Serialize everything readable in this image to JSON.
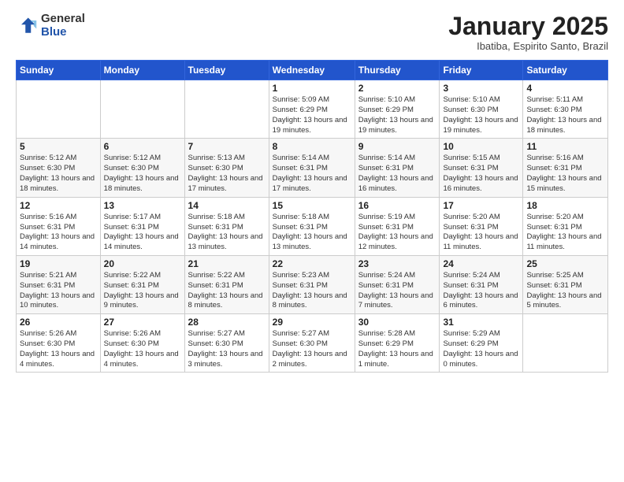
{
  "logo": {
    "general": "General",
    "blue": "Blue"
  },
  "header": {
    "month": "January 2025",
    "location": "Ibatiba, Espirito Santo, Brazil"
  },
  "weekdays": [
    "Sunday",
    "Monday",
    "Tuesday",
    "Wednesday",
    "Thursday",
    "Friday",
    "Saturday"
  ],
  "weeks": [
    [
      {
        "day": "",
        "info": ""
      },
      {
        "day": "",
        "info": ""
      },
      {
        "day": "",
        "info": ""
      },
      {
        "day": "1",
        "info": "Sunrise: 5:09 AM\nSunset: 6:29 PM\nDaylight: 13 hours\nand 19 minutes."
      },
      {
        "day": "2",
        "info": "Sunrise: 5:10 AM\nSunset: 6:29 PM\nDaylight: 13 hours\nand 19 minutes."
      },
      {
        "day": "3",
        "info": "Sunrise: 5:10 AM\nSunset: 6:30 PM\nDaylight: 13 hours\nand 19 minutes."
      },
      {
        "day": "4",
        "info": "Sunrise: 5:11 AM\nSunset: 6:30 PM\nDaylight: 13 hours\nand 18 minutes."
      }
    ],
    [
      {
        "day": "5",
        "info": "Sunrise: 5:12 AM\nSunset: 6:30 PM\nDaylight: 13 hours\nand 18 minutes."
      },
      {
        "day": "6",
        "info": "Sunrise: 5:12 AM\nSunset: 6:30 PM\nDaylight: 13 hours\nand 18 minutes."
      },
      {
        "day": "7",
        "info": "Sunrise: 5:13 AM\nSunset: 6:30 PM\nDaylight: 13 hours\nand 17 minutes."
      },
      {
        "day": "8",
        "info": "Sunrise: 5:14 AM\nSunset: 6:31 PM\nDaylight: 13 hours\nand 17 minutes."
      },
      {
        "day": "9",
        "info": "Sunrise: 5:14 AM\nSunset: 6:31 PM\nDaylight: 13 hours\nand 16 minutes."
      },
      {
        "day": "10",
        "info": "Sunrise: 5:15 AM\nSunset: 6:31 PM\nDaylight: 13 hours\nand 16 minutes."
      },
      {
        "day": "11",
        "info": "Sunrise: 5:16 AM\nSunset: 6:31 PM\nDaylight: 13 hours\nand 15 minutes."
      }
    ],
    [
      {
        "day": "12",
        "info": "Sunrise: 5:16 AM\nSunset: 6:31 PM\nDaylight: 13 hours\nand 14 minutes."
      },
      {
        "day": "13",
        "info": "Sunrise: 5:17 AM\nSunset: 6:31 PM\nDaylight: 13 hours\nand 14 minutes."
      },
      {
        "day": "14",
        "info": "Sunrise: 5:18 AM\nSunset: 6:31 PM\nDaylight: 13 hours\nand 13 minutes."
      },
      {
        "day": "15",
        "info": "Sunrise: 5:18 AM\nSunset: 6:31 PM\nDaylight: 13 hours\nand 13 minutes."
      },
      {
        "day": "16",
        "info": "Sunrise: 5:19 AM\nSunset: 6:31 PM\nDaylight: 13 hours\nand 12 minutes."
      },
      {
        "day": "17",
        "info": "Sunrise: 5:20 AM\nSunset: 6:31 PM\nDaylight: 13 hours\nand 11 minutes."
      },
      {
        "day": "18",
        "info": "Sunrise: 5:20 AM\nSunset: 6:31 PM\nDaylight: 13 hours\nand 11 minutes."
      }
    ],
    [
      {
        "day": "19",
        "info": "Sunrise: 5:21 AM\nSunset: 6:31 PM\nDaylight: 13 hours\nand 10 minutes."
      },
      {
        "day": "20",
        "info": "Sunrise: 5:22 AM\nSunset: 6:31 PM\nDaylight: 13 hours\nand 9 minutes."
      },
      {
        "day": "21",
        "info": "Sunrise: 5:22 AM\nSunset: 6:31 PM\nDaylight: 13 hours\nand 8 minutes."
      },
      {
        "day": "22",
        "info": "Sunrise: 5:23 AM\nSunset: 6:31 PM\nDaylight: 13 hours\nand 8 minutes."
      },
      {
        "day": "23",
        "info": "Sunrise: 5:24 AM\nSunset: 6:31 PM\nDaylight: 13 hours\nand 7 minutes."
      },
      {
        "day": "24",
        "info": "Sunrise: 5:24 AM\nSunset: 6:31 PM\nDaylight: 13 hours\nand 6 minutes."
      },
      {
        "day": "25",
        "info": "Sunrise: 5:25 AM\nSunset: 6:31 PM\nDaylight: 13 hours\nand 5 minutes."
      }
    ],
    [
      {
        "day": "26",
        "info": "Sunrise: 5:26 AM\nSunset: 6:30 PM\nDaylight: 13 hours\nand 4 minutes."
      },
      {
        "day": "27",
        "info": "Sunrise: 5:26 AM\nSunset: 6:30 PM\nDaylight: 13 hours\nand 4 minutes."
      },
      {
        "day": "28",
        "info": "Sunrise: 5:27 AM\nSunset: 6:30 PM\nDaylight: 13 hours\nand 3 minutes."
      },
      {
        "day": "29",
        "info": "Sunrise: 5:27 AM\nSunset: 6:30 PM\nDaylight: 13 hours\nand 2 minutes."
      },
      {
        "day": "30",
        "info": "Sunrise: 5:28 AM\nSunset: 6:29 PM\nDaylight: 13 hours\nand 1 minute."
      },
      {
        "day": "31",
        "info": "Sunrise: 5:29 AM\nSunset: 6:29 PM\nDaylight: 13 hours\nand 0 minutes."
      },
      {
        "day": "",
        "info": ""
      }
    ]
  ]
}
